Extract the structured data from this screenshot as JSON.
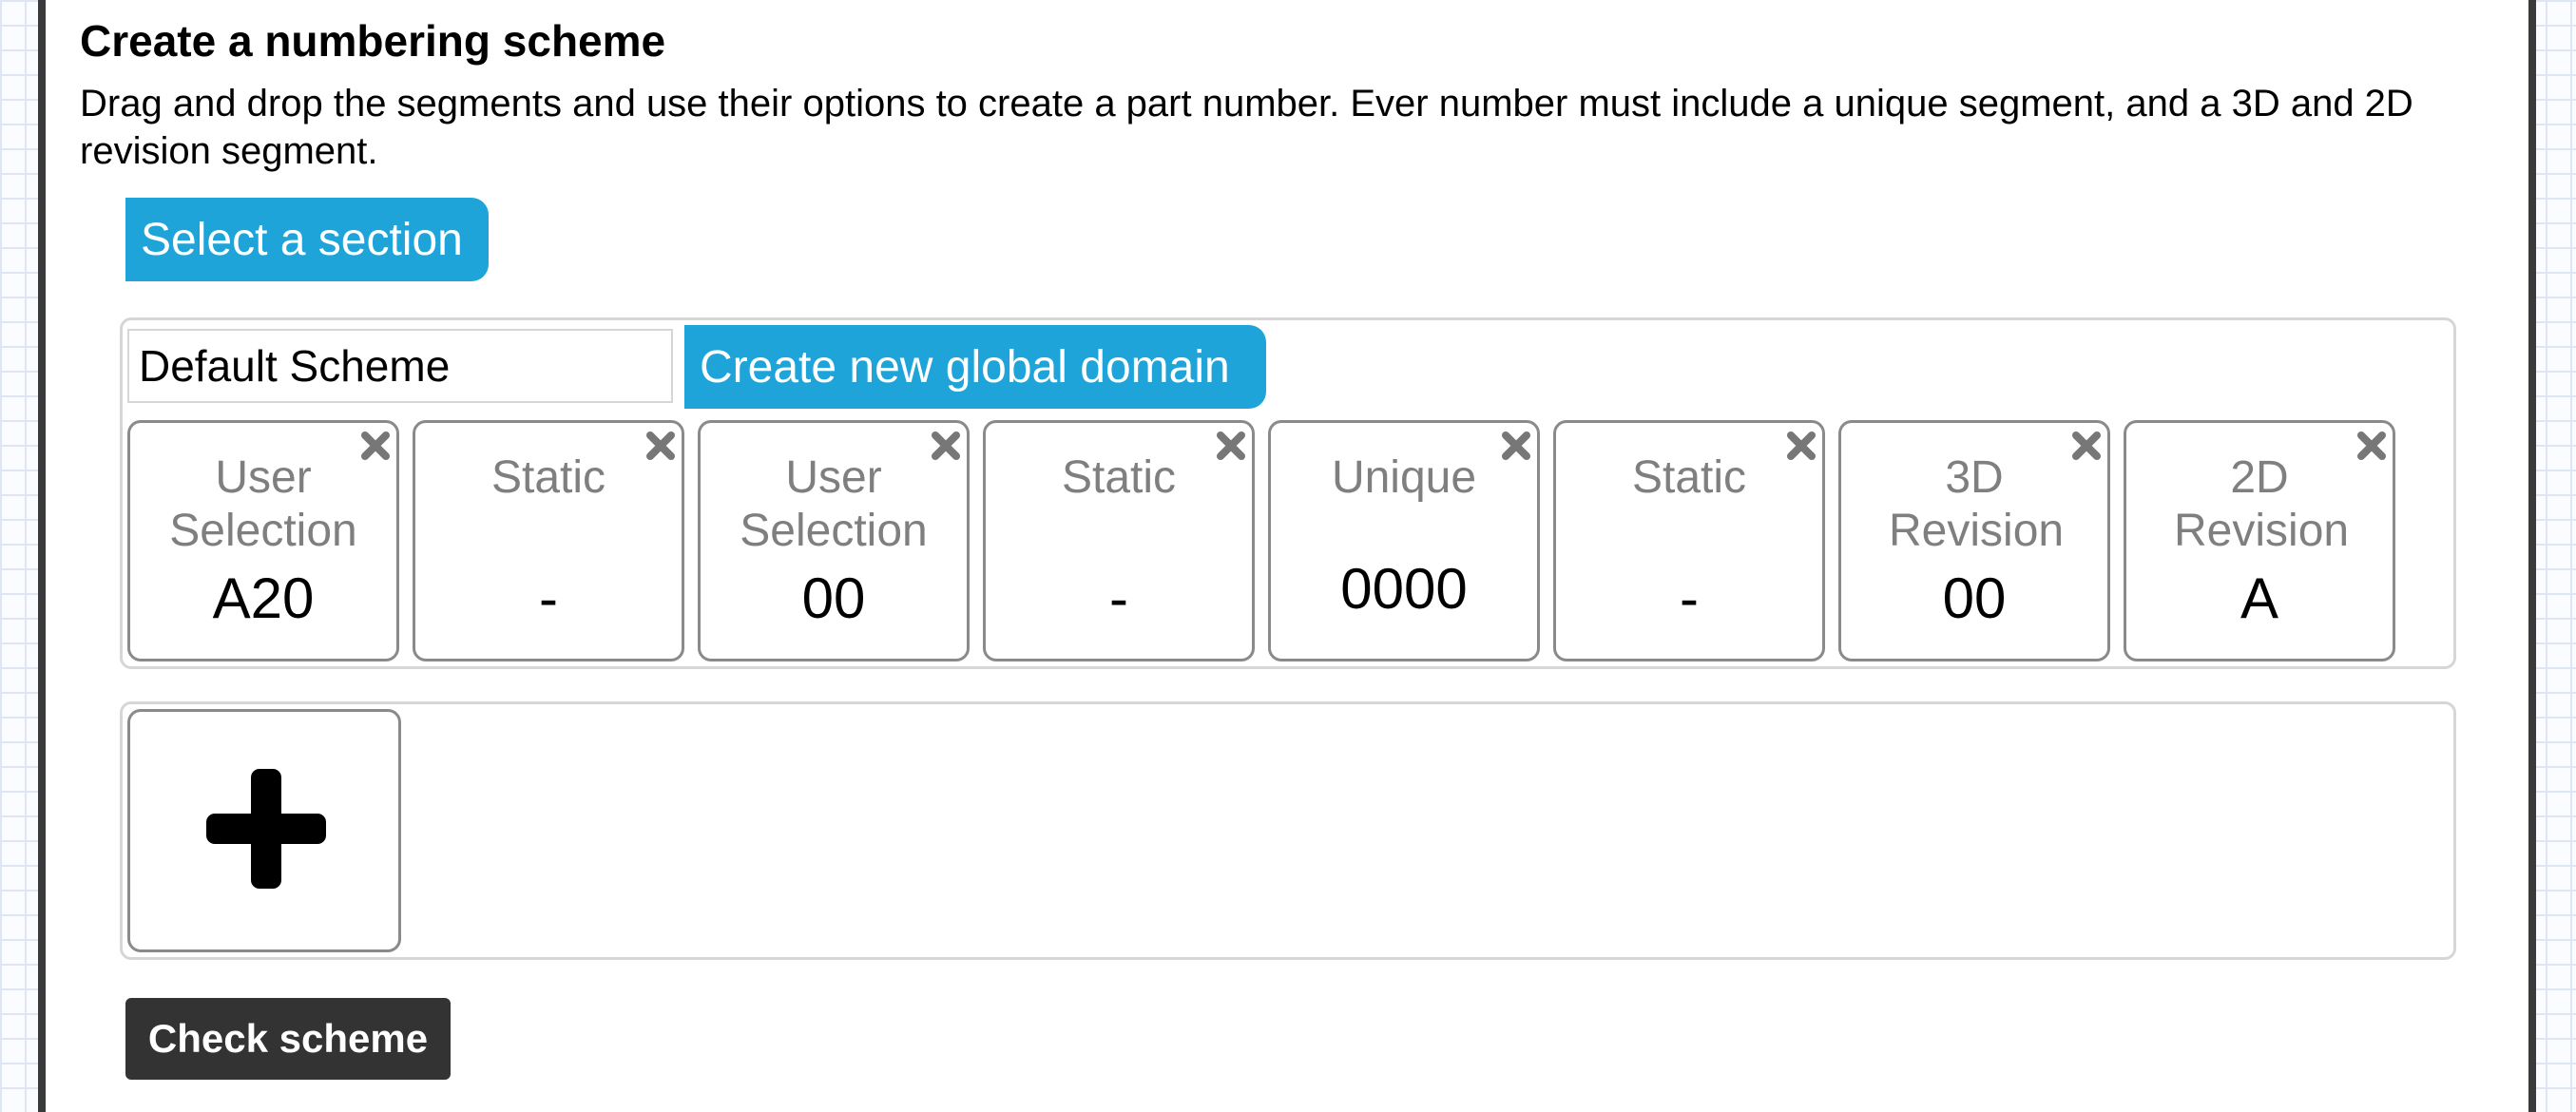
{
  "page": {
    "title": "Create a numbering scheme",
    "description": "Drag and drop the segments and use their options to create a part number. Ever number must include a unique segment, and a 3D and 2D revision segment."
  },
  "buttons": {
    "select_section": "Select a section",
    "create_global_domain": "Create new global domain",
    "check_scheme": "Check scheme"
  },
  "scheme": {
    "name_value": "Default Scheme",
    "segments": [
      {
        "type": "User Selection",
        "value": "A20"
      },
      {
        "type": "Static",
        "value": "-"
      },
      {
        "type": "User Selection",
        "value": "00"
      },
      {
        "type": "Static",
        "value": "-"
      },
      {
        "type": "Unique",
        "value": "0000"
      },
      {
        "type": "Static",
        "value": "-"
      },
      {
        "type": "3D Revision",
        "value": "00"
      },
      {
        "type": "2D Revision",
        "value": "A"
      }
    ]
  },
  "colors": {
    "accent": "#1ea4d9",
    "dark_button": "#333333",
    "segment_label": "#7f7f7f"
  },
  "icons": {
    "remove": "close-icon",
    "add": "plus-icon"
  }
}
